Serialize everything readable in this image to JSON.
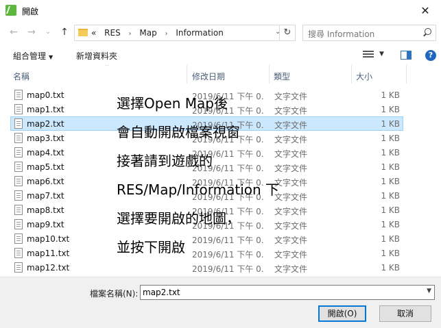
{
  "window": {
    "title": "開啟",
    "close_glyph": "✕"
  },
  "nav": {
    "back_glyph": "←",
    "forward_glyph": "→",
    "recent_glyph": "⌄",
    "up_glyph": "↑",
    "crumbs": [
      "«",
      "RES",
      "Map",
      "Information"
    ],
    "search_placeholder": "搜尋 Information",
    "refresh_glyph": "↻"
  },
  "toolbar": {
    "organize_label": "組合管理",
    "new_folder_label": "新增資料夾"
  },
  "columns": {
    "name": "名稱",
    "date": "修改日期",
    "type": "類型",
    "size": "大小"
  },
  "files": [
    {
      "name": "map0.txt",
      "date": "2019/6/11 下午 0...",
      "type": "文字文件",
      "size": "1 KB",
      "selected": false
    },
    {
      "name": "map1.txt",
      "date": "2019/6/11 下午 0...",
      "type": "文字文件",
      "size": "1 KB",
      "selected": false
    },
    {
      "name": "map2.txt",
      "date": "2019/6/11 下午 0...",
      "type": "文字文件",
      "size": "1 KB",
      "selected": true
    },
    {
      "name": "map3.txt",
      "date": "2019/6/11 下午 0...",
      "type": "文字文件",
      "size": "1 KB",
      "selected": false
    },
    {
      "name": "map4.txt",
      "date": "2019/6/11 下午 0...",
      "type": "文字文件",
      "size": "1 KB",
      "selected": false
    },
    {
      "name": "map5.txt",
      "date": "2019/6/11 下午 0...",
      "type": "文字文件",
      "size": "1 KB",
      "selected": false
    },
    {
      "name": "map6.txt",
      "date": "2019/6/11 下午 0...",
      "type": "文字文件",
      "size": "1 KB",
      "selected": false
    },
    {
      "name": "map7.txt",
      "date": "2019/6/11 下午 0...",
      "type": "文字文件",
      "size": "1 KB",
      "selected": false
    },
    {
      "name": "map8.txt",
      "date": "2019/6/11 下午 0...",
      "type": "文字文件",
      "size": "1 KB",
      "selected": false
    },
    {
      "name": "map9.txt",
      "date": "2019/6/11 下午 0...",
      "type": "文字文件",
      "size": "1 KB",
      "selected": false
    },
    {
      "name": "map10.txt",
      "date": "2019/6/11 下午 0...",
      "type": "文字文件",
      "size": "1 KB",
      "selected": false
    },
    {
      "name": "map11.txt",
      "date": "2019/6/11 下午 0...",
      "type": "文字文件",
      "size": "1 KB",
      "selected": false
    },
    {
      "name": "map12.txt",
      "date": "2019/6/11 下午 0...",
      "type": "文字文件",
      "size": "1 KB",
      "selected": false
    }
  ],
  "instructions": [
    "選擇Open Map後",
    "會自動開啟檔案視窗",
    "接著請到遊戲的",
    "RES/Map/Information 下",
    "選擇要開啟的地圖，",
    "並按下開啟"
  ],
  "footer": {
    "filename_label": "檔案名稱(N):",
    "filename_value": "map2.txt",
    "open_label": "開啟(O)",
    "cancel_label": "取消"
  },
  "colors": {
    "selection": "#cce8ff",
    "accent": "#0078d7"
  }
}
